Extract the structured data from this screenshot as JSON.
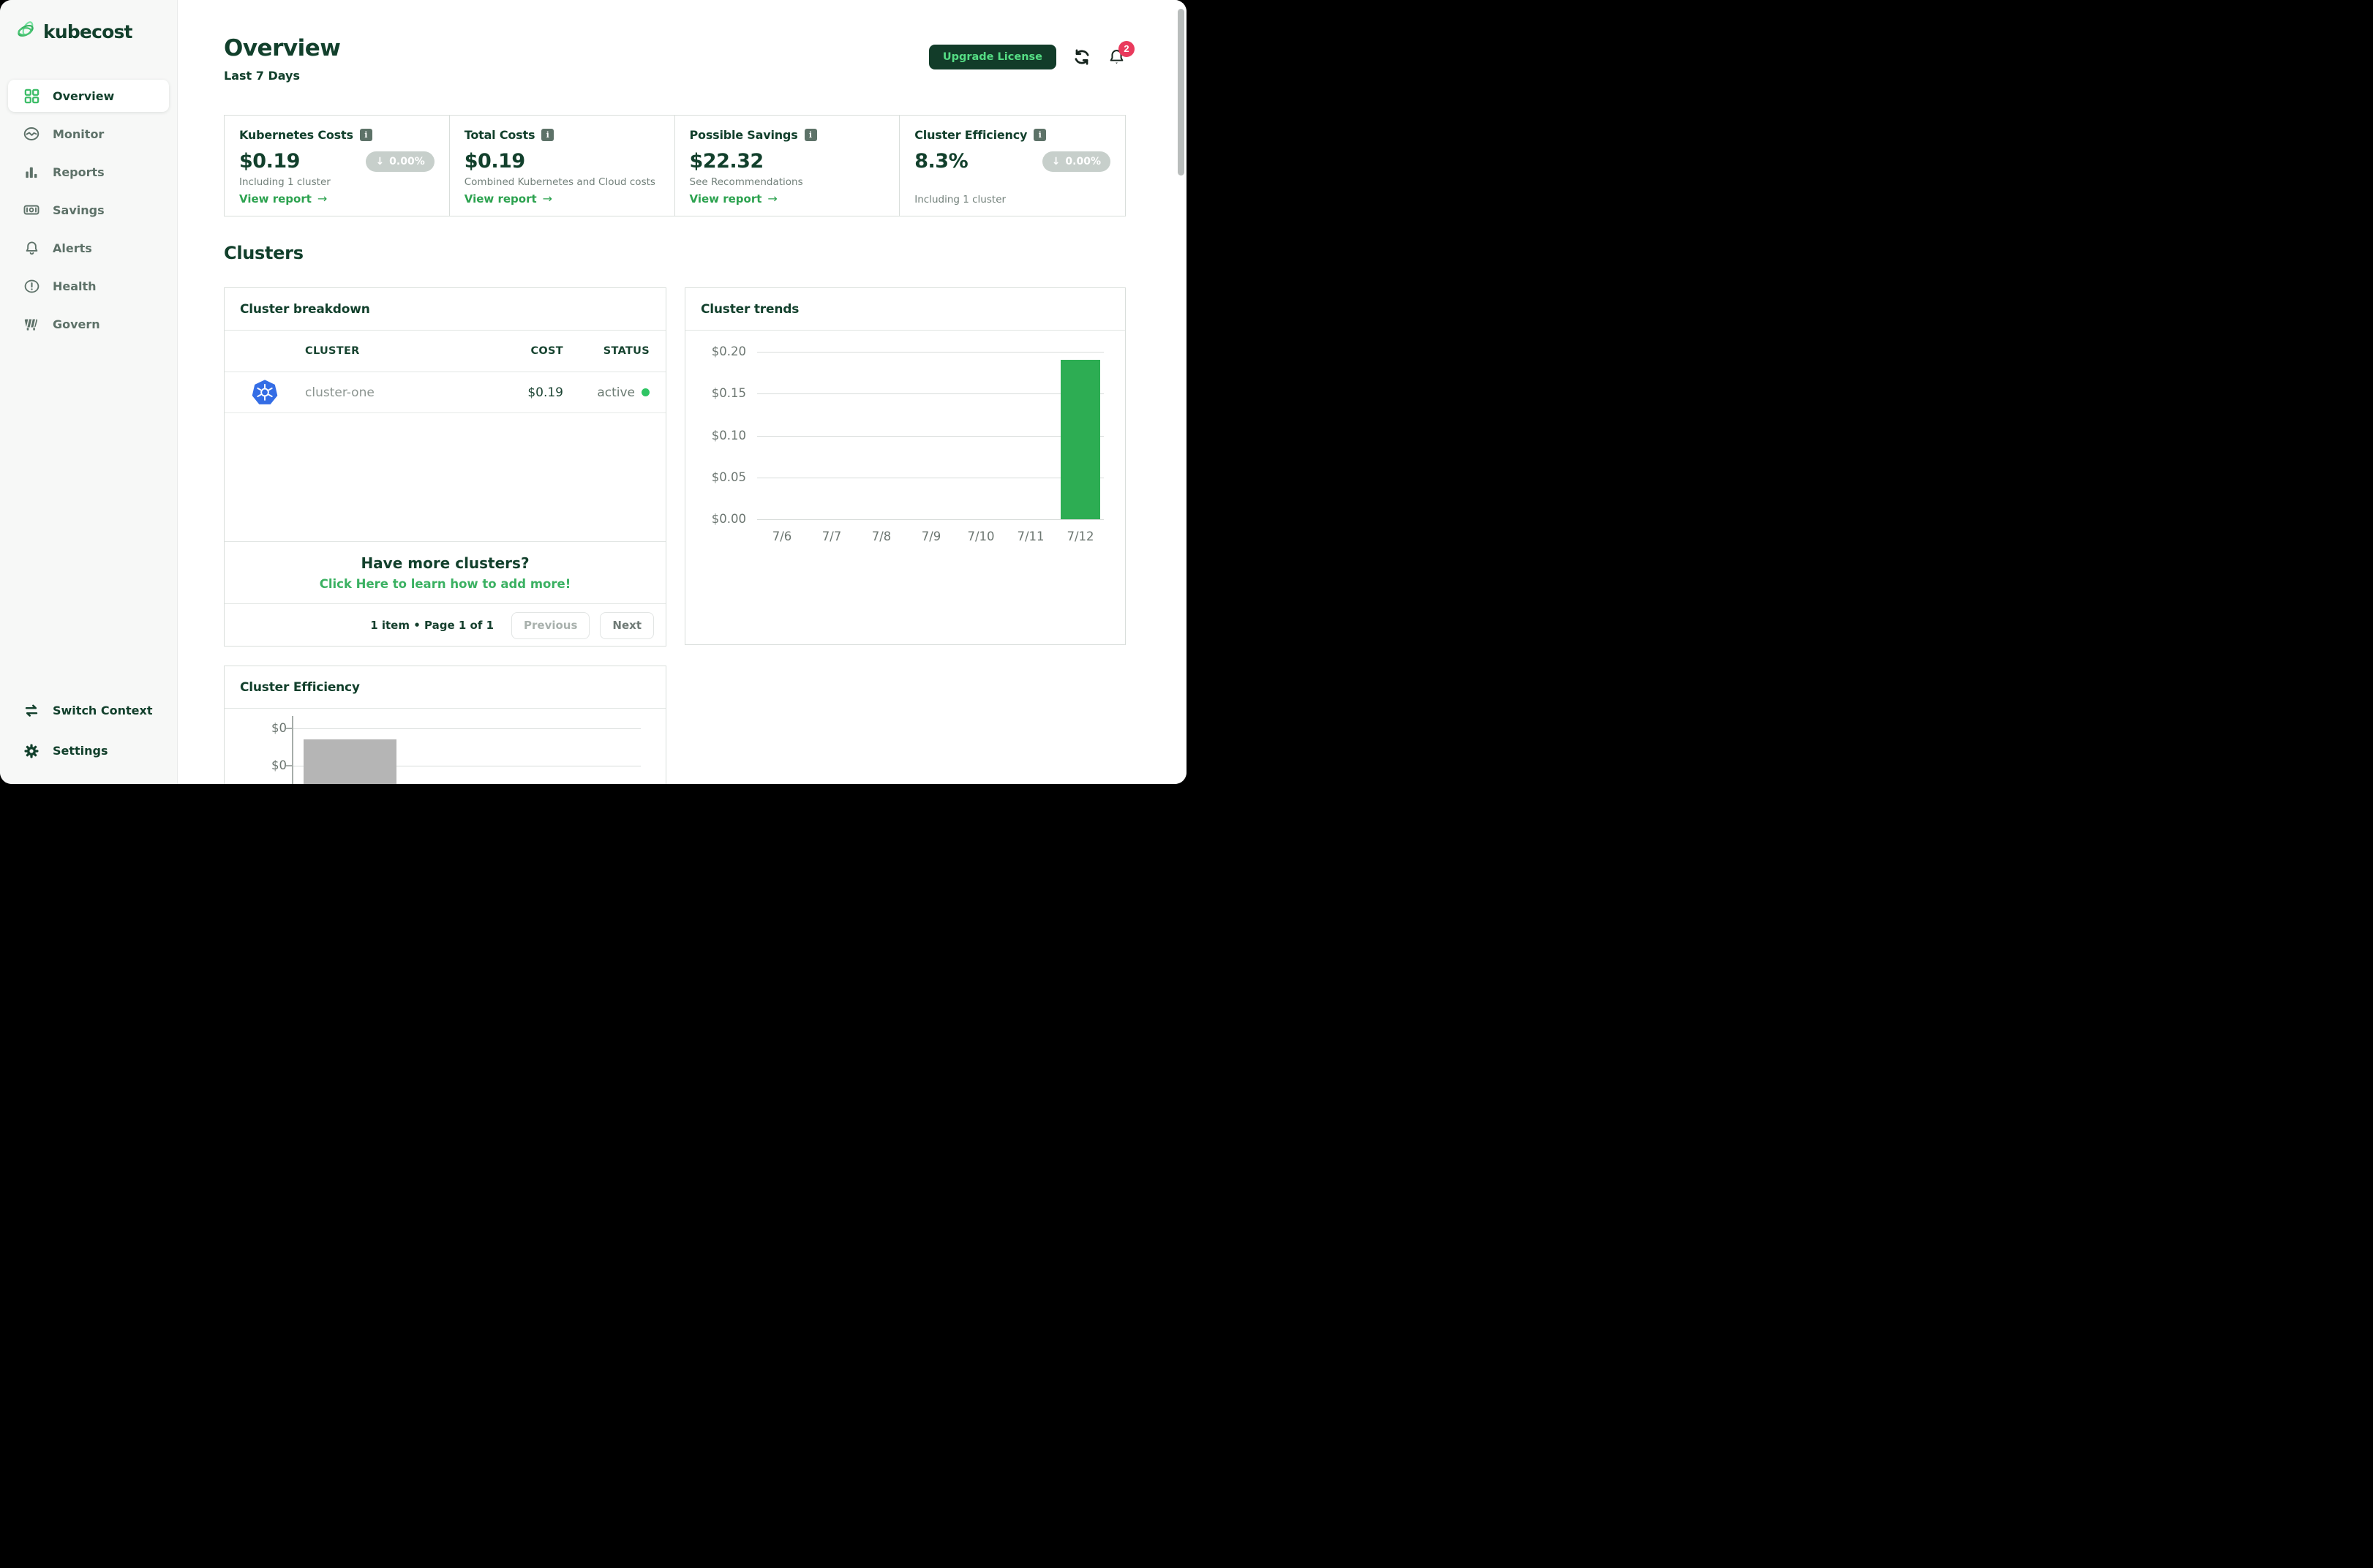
{
  "brand": {
    "name": "kubecost"
  },
  "sidebar": {
    "items": [
      {
        "label": "Overview",
        "active": true
      },
      {
        "label": "Monitor"
      },
      {
        "label": "Reports"
      },
      {
        "label": "Savings"
      },
      {
        "label": "Alerts"
      },
      {
        "label": "Health"
      },
      {
        "label": "Govern"
      }
    ],
    "footer": [
      {
        "label": "Switch Context"
      },
      {
        "label": "Settings"
      }
    ]
  },
  "header": {
    "title": "Overview",
    "subtitle": "Last 7 Days",
    "upgrade_button": "Upgrade License",
    "notification_count": "2"
  },
  "icons": {
    "arrow_right": "→",
    "arrow_down": "↓",
    "info": "i"
  },
  "stat_cards": [
    {
      "title": "Kubernetes Costs",
      "value": "$0.19",
      "delta": "0.00%",
      "note": "Including 1 cluster",
      "link": "View report"
    },
    {
      "title": "Total Costs",
      "value": "$0.19",
      "note": "Combined Kubernetes and Cloud costs",
      "link": "View report"
    },
    {
      "title": "Possible Savings",
      "value": "$22.32",
      "note": "See Recommendations",
      "link": "View report"
    },
    {
      "title": "Cluster Efficiency",
      "value": "8.3%",
      "delta": "0.00%",
      "note": "Including 1 cluster"
    }
  ],
  "clusters": {
    "heading": "Clusters",
    "breakdown": {
      "title": "Cluster breakdown",
      "columns": [
        "CLUSTER",
        "COST",
        "STATUS"
      ],
      "rows": [
        {
          "cluster": "cluster-one",
          "cost": "$0.19",
          "status": "active"
        }
      ],
      "prompt_title": "Have more clusters?",
      "prompt_link": "Click Here to learn how to add more!",
      "pagination": "1 item • Page 1 of 1",
      "previous": "Previous",
      "next": "Next"
    },
    "trends": {
      "title": "Cluster trends"
    },
    "efficiency": {
      "title": "Cluster Efficiency"
    }
  },
  "chart_data": [
    {
      "type": "bar",
      "title": "Cluster trends",
      "categories": [
        "7/6",
        "7/7",
        "7/8",
        "7/9",
        "7/10",
        "7/11",
        "7/12"
      ],
      "values": [
        0,
        0,
        0,
        0,
        0,
        0,
        0.19
      ],
      "yticks": [
        "$0.20",
        "$0.15",
        "$0.10",
        "$0.05",
        "$0.00"
      ],
      "ylim": [
        0,
        0.2
      ],
      "xlabel": "",
      "ylabel": "",
      "grid": true,
      "legend_position": "none",
      "bar_color": "#2dad53"
    },
    {
      "type": "bar",
      "title": "Cluster Efficiency",
      "yticks": [
        "$0",
        "$0"
      ],
      "note": "chart cut off at bottom edge of viewport; single gray bar visible at left",
      "bar_color": "#b5b5b5"
    }
  ],
  "colors": {
    "brand_dark_green": "#12402c",
    "accent_green": "#2ca24f",
    "link_green": "#3bb162",
    "upgrade_button_bg": "#123c29",
    "upgrade_button_text": "#55dd84",
    "delta_pill_gray": "#c7cfcb",
    "notification_badge_red": "#e93a5c",
    "status_active_dot": "#2fc564",
    "kubernetes_blue": "#346de5",
    "trend_bar_green": "#2dad53",
    "efficiency_bar_gray": "#b5b5b5",
    "sidebar_bg": "#f7f8f7"
  }
}
